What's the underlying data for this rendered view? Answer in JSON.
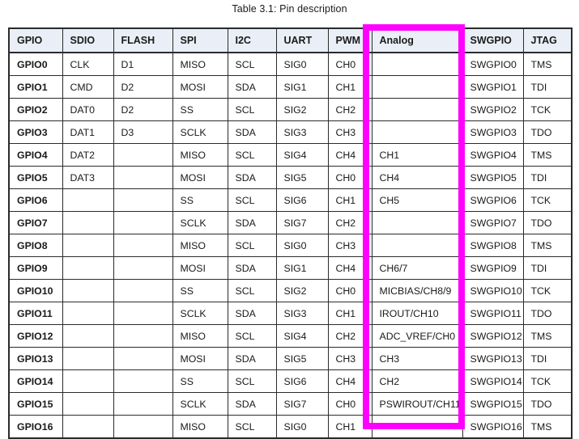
{
  "caption": "Table 3.1: Pin description",
  "table": {
    "columns": [
      "GPIO",
      "SDIO",
      "FLASH",
      "SPI",
      "I2C",
      "UART",
      "PWM",
      "Analog",
      "SWGPIO",
      "JTAG"
    ],
    "rows": [
      [
        "GPIO0",
        "CLK",
        "D1",
        "MISO",
        "SCL",
        "SIG0",
        "CH0",
        "",
        "SWGPIO0",
        "TMS"
      ],
      [
        "GPIO1",
        "CMD",
        "D2",
        "MOSI",
        "SDA",
        "SIG1",
        "CH1",
        "",
        "SWGPIO1",
        "TDI"
      ],
      [
        "GPIO2",
        "DAT0",
        "D2",
        "SS",
        "SCL",
        "SIG2",
        "CH2",
        "",
        "SWGPIO2",
        "TCK"
      ],
      [
        "GPIO3",
        "DAT1",
        "D3",
        "SCLK",
        "SDA",
        "SIG3",
        "CH3",
        "",
        "SWGPIO3",
        "TDO"
      ],
      [
        "GPIO4",
        "DAT2",
        "",
        "MISO",
        "SCL",
        "SIG4",
        "CH4",
        "CH1",
        "SWGPIO4",
        "TMS"
      ],
      [
        "GPIO5",
        "DAT3",
        "",
        "MOSI",
        "SDA",
        "SIG5",
        "CH0",
        "CH4",
        "SWGPIO5",
        "TDI"
      ],
      [
        "GPIO6",
        "",
        "",
        "SS",
        "SCL",
        "SIG6",
        "CH1",
        "CH5",
        "SWGPIO6",
        "TCK"
      ],
      [
        "GPIO7",
        "",
        "",
        "SCLK",
        "SDA",
        "SIG7",
        "CH2",
        "",
        "SWGPIO7",
        "TDO"
      ],
      [
        "GPIO8",
        "",
        "",
        "MISO",
        "SCL",
        "SIG0",
        "CH3",
        "",
        "SWGPIO8",
        "TMS"
      ],
      [
        "GPIO9",
        "",
        "",
        "MOSI",
        "SDA",
        "SIG1",
        "CH4",
        "CH6/7",
        "SWGPIO9",
        "TDI"
      ],
      [
        "GPIO10",
        "",
        "",
        "SS",
        "SCL",
        "SIG2",
        "CH0",
        "MICBIAS/CH8/9",
        "SWGPIO10",
        "TCK"
      ],
      [
        "GPIO11",
        "",
        "",
        "SCLK",
        "SDA",
        "SIG3",
        "CH1",
        "IROUT/CH10",
        "SWGPIO11",
        "TDO"
      ],
      [
        "GPIO12",
        "",
        "",
        "MISO",
        "SCL",
        "SIG4",
        "CH2",
        "ADC_VREF/CH0",
        "SWGPIO12",
        "TMS"
      ],
      [
        "GPIO13",
        "",
        "",
        "MOSI",
        "SDA",
        "SIG5",
        "CH3",
        "CH3",
        "SWGPIO13",
        "TDI"
      ],
      [
        "GPIO14",
        "",
        "",
        "SS",
        "SCL",
        "SIG6",
        "CH4",
        "CH2",
        "SWGPIO14",
        "TCK"
      ],
      [
        "GPIO15",
        "",
        "",
        "SCLK",
        "SDA",
        "SIG7",
        "CH0",
        "PSWIROUT/CH11",
        "SWGPIO15",
        "TDO"
      ],
      [
        "GPIO16",
        "",
        "",
        "MISO",
        "SCL",
        "SIG0",
        "CH1",
        "",
        "SWGPIO16",
        "TMS"
      ]
    ]
  },
  "annotation": {
    "highlight_color": "#ff00ff",
    "highlight_target_column": "Analog"
  },
  "colors": {
    "header_background": "#eaeff7",
    "border": "#2b2b2b",
    "text": "#1a1a1a",
    "page_background": "#ffffff"
  }
}
